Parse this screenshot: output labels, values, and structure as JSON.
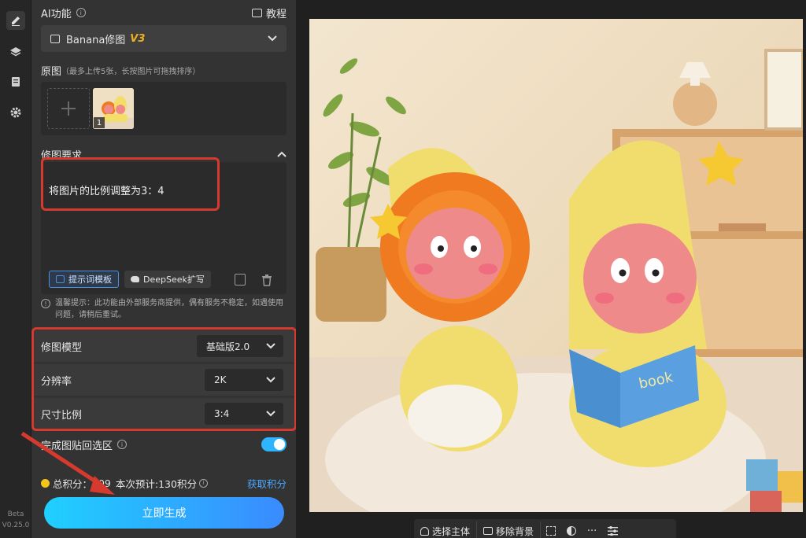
{
  "app": {
    "beta_label": "Beta",
    "version": "V0.25.0"
  },
  "toolbar": {
    "items": [
      "edit-icon",
      "layers-icon",
      "document-icon",
      "gear-icon"
    ]
  },
  "ai_section": {
    "title": "AI功能",
    "tutorial_label": "教程"
  },
  "model_select": {
    "name": "Banana修图",
    "badge": "V3"
  },
  "original": {
    "title": "原图",
    "hint": "（最多上传5张，长按图片可拖拽排序）",
    "thumb_index": "1"
  },
  "requirements": {
    "title": "修图要求",
    "text": "将图片的比例调整为3：4",
    "template_label": "提示词模板",
    "deepseek_label": "DeepSeek扩写"
  },
  "tip": {
    "text": "温馨提示：此功能由外部服务商提供，偶有服务不稳定，如遇使用问题，请稍后重试。"
  },
  "settings": [
    {
      "label": "修图模型",
      "value": "基础版2.0"
    },
    {
      "label": "分辨率",
      "value": "2K"
    },
    {
      "label": "尺寸比例",
      "value": "3:4"
    }
  ],
  "paste_back": {
    "label": "完成图贴回选区",
    "enabled": true
  },
  "credits": {
    "total_label": "总积分：",
    "total_value": "209",
    "estimate_label": "本次预计:130积分",
    "get_label": "获取积分"
  },
  "generate_label": "立即生成",
  "bottom_bar": {
    "select_subject": "选择主体",
    "remove_bg": "移除背景"
  },
  "illustration": {
    "book_text": "book"
  },
  "colors": {
    "accent": "#2fb5ff",
    "highlight_box": "#d63a2e",
    "link": "#4aa8ff"
  }
}
